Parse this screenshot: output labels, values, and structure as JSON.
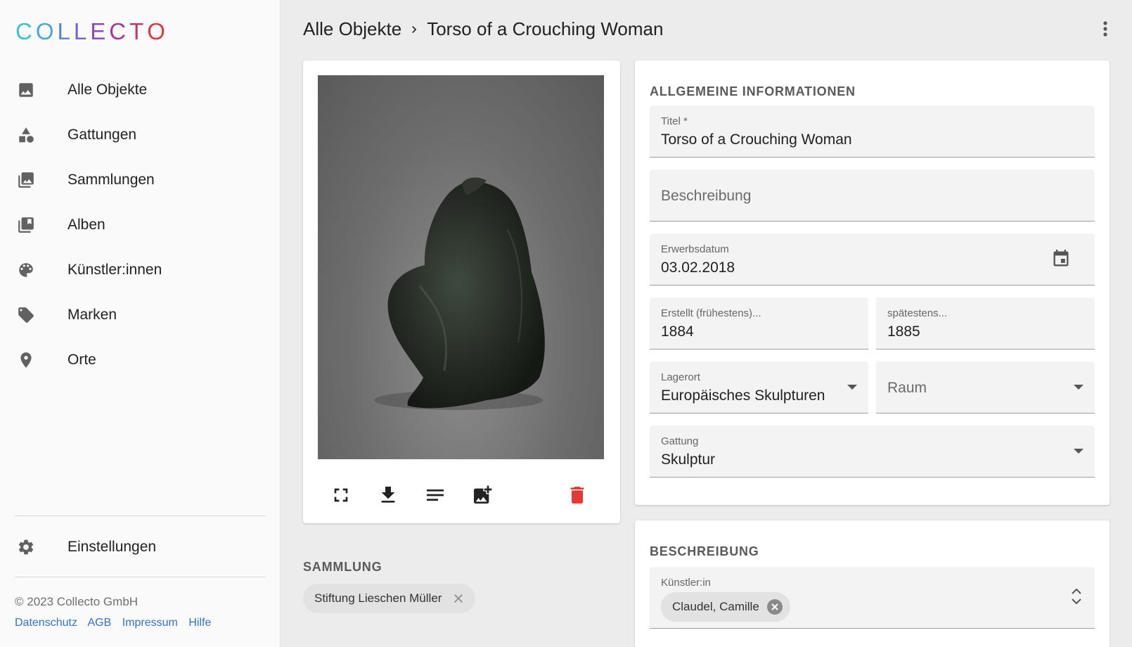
{
  "app": {
    "logo_letters": [
      "C",
      "O",
      "L",
      "L",
      "E",
      "C",
      "T",
      "O"
    ],
    "logo_colors": [
      "#3fc3c6",
      "#4aa7d7",
      "#5a86d8",
      "#7264d2",
      "#8b47c4",
      "#a8389f",
      "#c5346d",
      "#e0383e"
    ]
  },
  "sidebar": {
    "items": [
      {
        "label": "Alle Objekte",
        "icon": "image-icon"
      },
      {
        "label": "Gattungen",
        "icon": "category-icon"
      },
      {
        "label": "Sammlungen",
        "icon": "photo-library-icon"
      },
      {
        "label": "Alben",
        "icon": "library-books-icon"
      },
      {
        "label": "Künstler:innen",
        "icon": "palette-icon"
      },
      {
        "label": "Marken",
        "icon": "tag-icon"
      },
      {
        "label": "Orte",
        "icon": "location-pin-icon"
      }
    ],
    "settings_label": "Einstellungen",
    "copyright": "© 2023 Collecto GmbH",
    "links": [
      "Datenschutz",
      "AGB",
      "Impressum",
      "Hilfe"
    ]
  },
  "header": {
    "breadcrumb_root": "Alle Objekte",
    "breadcrumb_current": "Torso of a Crouching Woman"
  },
  "image_panel": {
    "actions": [
      "fullscreen-icon",
      "download-icon",
      "notes-icon",
      "add-image-icon",
      "delete-icon"
    ],
    "delete_color": "#e53935"
  },
  "collection": {
    "title": "SAMMLUNG",
    "chip": "Stiftung Lieschen Müller"
  },
  "general": {
    "title": "ALLGEMEINE INFORMATIONEN",
    "titel_label": "Titel *",
    "titel_value": "Torso of a Crouching Woman",
    "beschreibung_placeholder": "Beschreibung",
    "erwerbsdatum_label": "Erwerbsdatum",
    "erwerbsdatum_value": "03.02.2018",
    "erstellt_label": "Erstellt (frühestens)...",
    "erstellt_value": "1884",
    "spaetestens_label": "spätestens...",
    "spaetestens_value": "1885",
    "lagerort_label": "Lagerort",
    "lagerort_value": "Europäisches Skulpturen",
    "raum_placeholder": "Raum",
    "gattung_label": "Gattung",
    "gattung_value": "Skulptur"
  },
  "description": {
    "title": "BESCHREIBUNG",
    "artist_label": "Künstler:in",
    "artist_chip": "Claudel, Camille"
  }
}
